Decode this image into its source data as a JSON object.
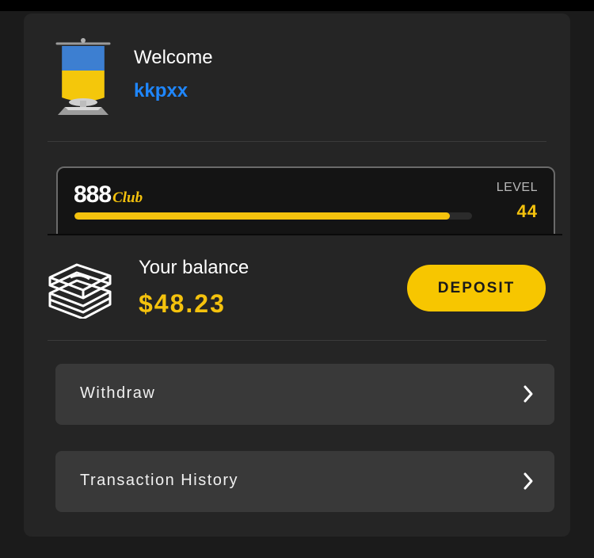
{
  "header": {
    "welcome": "Welcome",
    "username": "kkpxx"
  },
  "club": {
    "brand_number": "888",
    "brand_word": "Club",
    "level_label": "LEVEL",
    "level_value": "44",
    "progress_fraction": 0.945
  },
  "balance": {
    "label": "Your balance",
    "amount": "$48.23",
    "deposit_label": "DEPOSIT"
  },
  "menu": [
    {
      "label": "Withdraw",
      "icon": "chevron-right-icon"
    },
    {
      "label": "Transaction History",
      "icon": "chevron-right-icon"
    }
  ],
  "colors": {
    "accent": "#f4c20d",
    "username": "#1f87ff",
    "panel": "#252525",
    "menu_item": "#393939"
  }
}
